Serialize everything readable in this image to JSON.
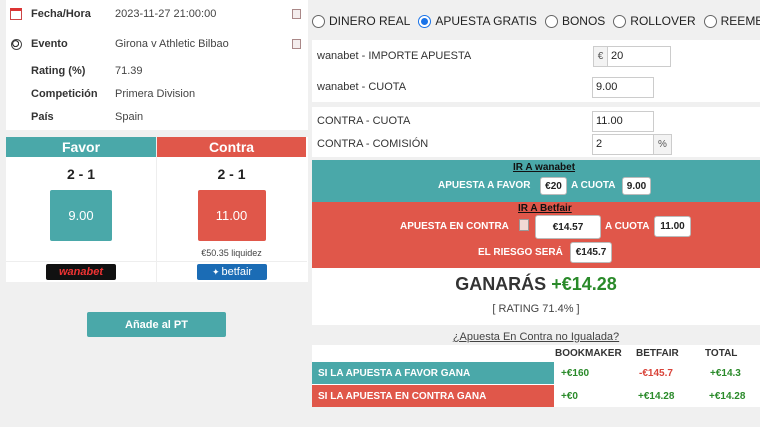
{
  "info": {
    "rows": [
      {
        "icon": "calendar-icon",
        "label": "Fecha/Hora",
        "value": "2023-11-27 21:00:00"
      },
      {
        "icon": "soccer-ball-icon",
        "label": "Evento",
        "value": "Girona v Athletic Bilbao"
      },
      {
        "label": "Rating (%)",
        "value": "71.39"
      },
      {
        "label": "Competición",
        "value": "Primera Division"
      },
      {
        "label": "País",
        "value": "Spain"
      }
    ]
  },
  "odds": {
    "favor": {
      "header": "Favor",
      "score": "2 - 1",
      "odd": "9.00",
      "logo": "wanabet"
    },
    "contra": {
      "header": "Contra",
      "score": "2 - 1",
      "odd": "11.00",
      "liquidity": "€50.35 liquidez",
      "logo": "betfair"
    }
  },
  "add_button": "Añade al PT",
  "modes": {
    "options": [
      "DINERO REAL",
      "APUESTA GRATIS",
      "BONOS",
      "ROLLOVER",
      "REEMBOLS"
    ],
    "selected": "APUESTA GRATIS"
  },
  "form": {
    "stake_label": "wanabet - IMPORTE APUESTA",
    "stake_currency": "€",
    "stake_value": "20",
    "odd_label": "wanabet - CUOTA",
    "odd_value": "9.00",
    "lay_odd_label": "CONTRA - CUOTA",
    "lay_odd_value": "11.00",
    "commission_label": "CONTRA - COMISIÓN",
    "commission_value": "2",
    "commission_unit": "%"
  },
  "result": {
    "ir_wanabet": "IR A wanabet",
    "favor_line": "APUESTA A FAVOR",
    "favor_amount": "€20",
    "at_odds": "A CUOTA",
    "favor_odd": "9.00",
    "ir_betfair": "IR A Betfair",
    "contra_line": "APUESTA EN CONTRA",
    "contra_amount": "€14.57",
    "contra_odd": "11.00",
    "risk_line": "EL RIESGO SERÁ",
    "risk_amount": "€145.7"
  },
  "gain": {
    "label": "GANARÁS",
    "amount": "+€14.28",
    "rating": "[ RATING 71.4% ]"
  },
  "no_igualada_link": "¿Apuesta En Contra no Igualada?",
  "table": {
    "headers": [
      "BOOKMAKER",
      "BETFAIR",
      "TOTAL"
    ],
    "rows": [
      {
        "label": "SI LA APUESTA A FAVOR GANA",
        "bookmaker": "+€160",
        "betfair": "-€145.7",
        "total": "+€14.3"
      },
      {
        "label": "SI LA APUESTA EN CONTRA GANA",
        "bookmaker": "+€0",
        "betfair": "+€14.28",
        "total": "+€14.28"
      }
    ]
  },
  "colors": {
    "teal": "#4aa8a9",
    "red": "#e0574a",
    "green": "#2a8a2a",
    "accent": "#1a73e8"
  }
}
